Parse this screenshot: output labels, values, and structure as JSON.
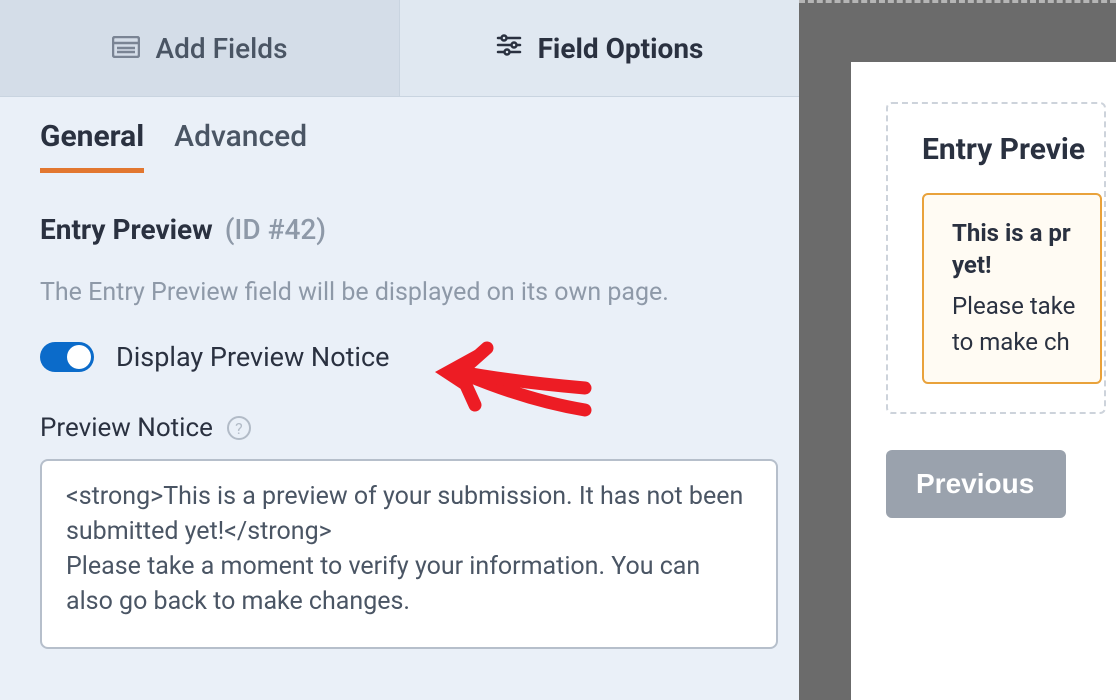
{
  "topTabs": {
    "addFields": "Add Fields",
    "fieldOptions": "Field Options"
  },
  "subTabs": {
    "general": "General",
    "advanced": "Advanced"
  },
  "section": {
    "title": "Entry Preview",
    "id": "(ID #42)"
  },
  "hint": "The Entry Preview field will be displayed on its own page.",
  "toggle": {
    "label": "Display Preview Notice"
  },
  "previewNotice": {
    "label": "Preview Notice",
    "value": "<strong>This is a preview of your submission. It has not been submitted yet!</strong>\nPlease take a moment to verify your information. You can also go back to make changes."
  },
  "preview": {
    "title": "Entry Previe",
    "noticeStrong1": "This is a pr",
    "noticeStrong2": "yet!",
    "noticeLine1": "Please take",
    "noticeLine2": "to make ch",
    "prevButton": "Previous"
  }
}
